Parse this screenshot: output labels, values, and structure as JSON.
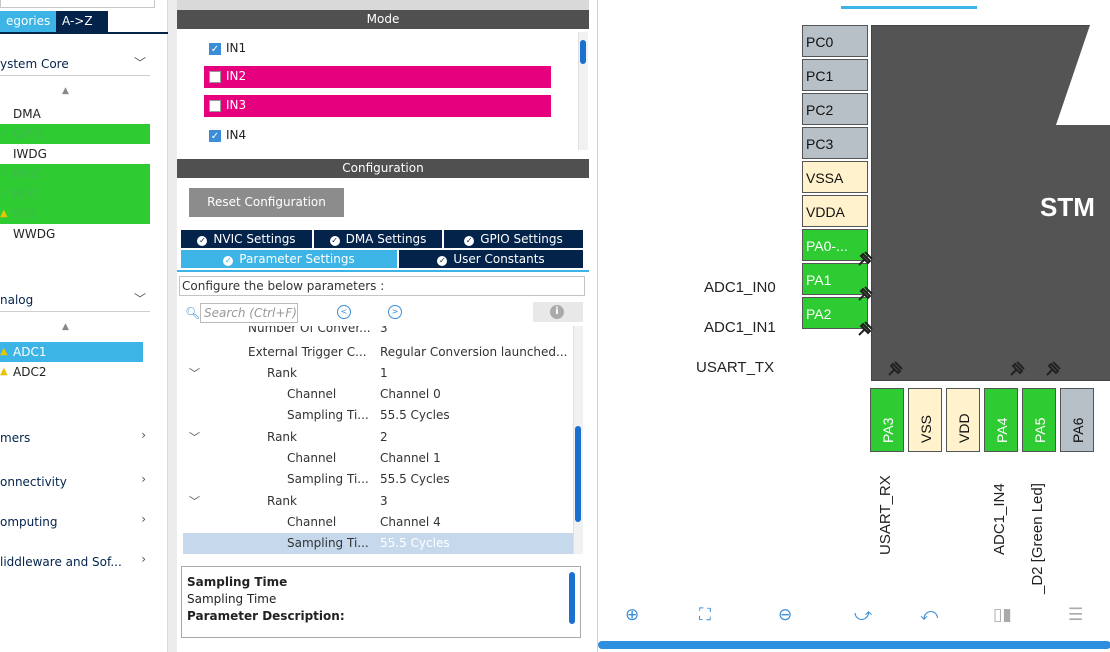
{
  "left": {
    "tabs": [
      "egories",
      "A->Z"
    ],
    "categories": [
      {
        "label": "ystem Core"
      },
      {
        "label": "nalog"
      },
      {
        "label": "mers"
      },
      {
        "label": "onnectivity"
      },
      {
        "label": "omputing"
      },
      {
        "label": "liddleware and Sof..."
      }
    ],
    "system_core_items": [
      {
        "label": "DMA",
        "status": "none"
      },
      {
        "label": "GPIO",
        "status": "ok"
      },
      {
        "label": "IWDG",
        "status": "none"
      },
      {
        "label": "NVIC",
        "status": "ok"
      },
      {
        "label": "RCC",
        "status": "ok"
      },
      {
        "label": "SYS",
        "status": "warn"
      },
      {
        "label": "WWDG",
        "status": "none"
      }
    ],
    "analog_items": [
      {
        "label": "ADC1",
        "status": "warn",
        "selected": true
      },
      {
        "label": "ADC2",
        "status": "warn",
        "selected": false
      }
    ]
  },
  "mode": {
    "header": "Mode",
    "rows": [
      {
        "label": "IN1",
        "checked": true,
        "highlight": false
      },
      {
        "label": "IN2",
        "checked": false,
        "highlight": true
      },
      {
        "label": "IN3",
        "checked": false,
        "highlight": true
      },
      {
        "label": "IN4",
        "checked": true,
        "highlight": false
      }
    ]
  },
  "config": {
    "header": "Configuration",
    "reset_label": "Reset Configuration",
    "tabs_row1": [
      "NVIC Settings",
      "DMA Settings",
      "GPIO Settings"
    ],
    "tabs_row2": [
      "Parameter Settings",
      "User Constants"
    ],
    "message": "Configure the below parameters :",
    "search_placeholder": "Search (Ctrl+F)",
    "tree": [
      {
        "key": "Number Of Conver...",
        "value": "3",
        "indent": 68,
        "toggle": ""
      },
      {
        "key": "External Trigger C...",
        "value": "Regular Conversion launched...",
        "indent": 68,
        "toggle": ""
      },
      {
        "key": "Rank",
        "value": "1",
        "indent": 86,
        "toggle": "⌄"
      },
      {
        "key": "Channel",
        "value": "Channel 0",
        "indent": 106,
        "toggle": ""
      },
      {
        "key": "Sampling Ti...",
        "value": "55.5 Cycles",
        "indent": 106,
        "toggle": ""
      },
      {
        "key": "Rank",
        "value": "2",
        "indent": 86,
        "toggle": "⌄"
      },
      {
        "key": "Channel",
        "value": "Channel 1",
        "indent": 106,
        "toggle": ""
      },
      {
        "key": "Sampling Ti...",
        "value": "55.5 Cycles",
        "indent": 106,
        "toggle": ""
      },
      {
        "key": "Rank",
        "value": "3",
        "indent": 86,
        "toggle": "⌄"
      },
      {
        "key": "Channel",
        "value": "Channel 4",
        "indent": 106,
        "toggle": ""
      },
      {
        "key": "Sampling Ti...",
        "value": "55.5 Cycles",
        "indent": 106,
        "toggle": "",
        "selected": true
      }
    ],
    "desc_title": "Sampling Time",
    "desc_sub": "Sampling Time",
    "desc_param": "Parameter Description:"
  },
  "pinout": {
    "chip_name": "STM",
    "left_pins": [
      {
        "label": "PC0",
        "color": "gray"
      },
      {
        "label": "PC1",
        "color": "gray"
      },
      {
        "label": "PC2",
        "color": "gray"
      },
      {
        "label": "PC3",
        "color": "gray"
      },
      {
        "label": "VSSA",
        "color": "yellow"
      },
      {
        "label": "VDDA",
        "color": "yellow"
      },
      {
        "label": "PA0-...",
        "color": "green"
      },
      {
        "label": "PA1",
        "color": "green"
      },
      {
        "label": "PA2",
        "color": "green"
      }
    ],
    "left_signals": [
      "ADC1_IN0",
      "ADC1_IN1",
      "USART_TX"
    ],
    "bottom_pins": [
      {
        "label": "PA3",
        "color": "green"
      },
      {
        "label": "VSS",
        "color": "yellow"
      },
      {
        "label": "VDD",
        "color": "yellow"
      },
      {
        "label": "PA4",
        "color": "green"
      },
      {
        "label": "PA5",
        "color": "green"
      },
      {
        "label": "PA6",
        "color": "gray"
      }
    ],
    "bottom_signals": [
      "USART_RX",
      "ADC1_IN4",
      "_D2 [Green Led]"
    ],
    "toolbar": [
      "zoom-in-icon",
      "fit-screen-icon",
      "zoom-out-icon",
      "rotate-right-icon",
      "rotate-left-icon",
      "split-vertical-icon",
      "split-horizontal-icon"
    ]
  }
}
